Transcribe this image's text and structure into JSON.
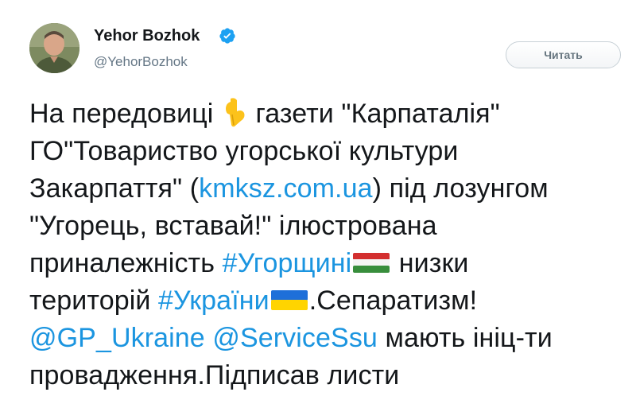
{
  "author": {
    "name": "Yehor Bozhok",
    "handle": "@YehorBozhok",
    "verified": true,
    "avatar": "avatar-photo"
  },
  "follow_button": {
    "label": "Читать"
  },
  "tweet": {
    "line1": {
      "text_a": "На передовиці",
      "emoji": "pointing-down-icon",
      "text_b": "газети \"Карпаталія\""
    },
    "line2": {
      "text": "ГО\"Товариство угорської культури"
    },
    "line3": {
      "text_a": "Закарпаття\" (",
      "link": "kmksz.com.ua",
      "text_b": ") під лозунгом"
    },
    "line4": {
      "text": "\"Угорець, вставай!\" ілюстрована"
    },
    "line5": {
      "text_a": "приналежність ",
      "hashtag": "#Угорщині",
      "emoji": "flag-hungary-icon",
      "text_b": " низки"
    },
    "line6": {
      "text_a": "територій ",
      "hashtag": "#України",
      "emoji": "flag-ukraine-icon",
      "text_b": ".Сепаратизм!"
    },
    "line7": {
      "mention1": "@GP_Ukraine",
      "space": " ",
      "mention2": "@ServiceSsu",
      "text_b": " мають ініц-ти"
    },
    "line8": {
      "text": "провадження.Підписав листи"
    }
  },
  "colors": {
    "link": "#1b95e0",
    "text": "#14171a",
    "muted": "#657786",
    "verified": "#1da1f2"
  }
}
